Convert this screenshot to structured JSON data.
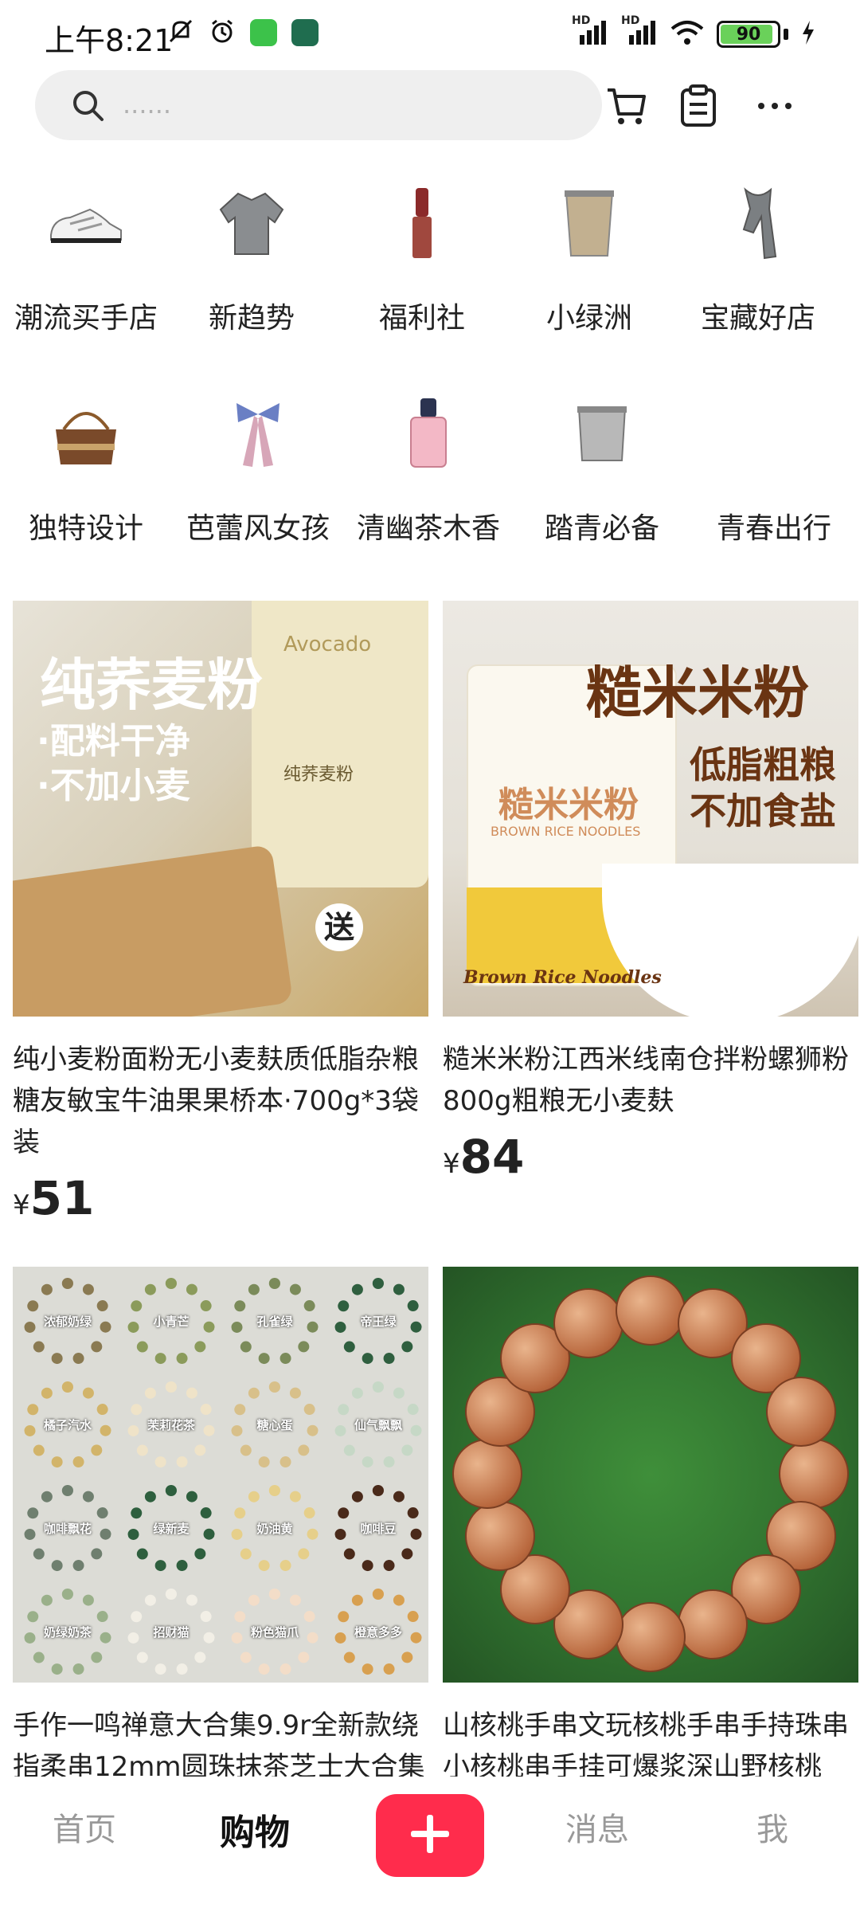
{
  "status_bar": {
    "time": "上午8:21",
    "net1": "HD",
    "net2": "HD",
    "battery_percent": 90
  },
  "search": {
    "placeholder": "......"
  },
  "categories": [
    {
      "label": "潮流买手店",
      "icon": "sneaker-icon"
    },
    {
      "label": "新趋势",
      "icon": "sweater-icon"
    },
    {
      "label": "福利社",
      "icon": "lipstick-icon"
    },
    {
      "label": "小绿洲",
      "icon": "cup-icon"
    },
    {
      "label": "宝藏好店",
      "icon": "scarf-icon"
    },
    {
      "label": "独特设计",
      "icon": "handbag-icon"
    },
    {
      "label": "芭蕾风女孩",
      "icon": "ribbon-icon"
    },
    {
      "label": "清幽茶木香",
      "icon": "perfume-icon"
    },
    {
      "label": "踏青必备",
      "icon": "steel-cup-icon"
    },
    {
      "label": "青春出行",
      "icon": "travel-icon"
    }
  ],
  "products": [
    {
      "title": "纯小麦粉面粉无小麦麸质低脂杂粮糖友敏宝牛油果果桥本·700g*3袋装",
      "price_symbol": "¥",
      "price": "51",
      "image_text": {
        "headline": "纯荞麦粉",
        "line1": "·配料干净",
        "line2": "·不加小麦",
        "badge": "送",
        "brand": "Avocado",
        "pack": "纯荞麦粉"
      }
    },
    {
      "title": "糙米米粉江西米线南仓拌粉螺狮粉800g粗粮无小麦麸",
      "price_symbol": "¥",
      "price": "84",
      "image_text": {
        "headline": "糙米米粉",
        "line1": "低脂粗粮",
        "line2": "不加食盐",
        "pack": "糙米米粉",
        "pack_en": "BROWN RICE NOODLES",
        "script": "Brown Rice Noodles"
      }
    },
    {
      "title": "手作一鸣禅意大合集9.9r全新款绕指柔串12mm圆珠抹茶芝士大合集",
      "image_text": {
        "labels": [
          "浓郁奶绿",
          "小青芒",
          "孔雀绿",
          "帝王绿",
          "橘子汽水",
          "茉莉花茶",
          "糖心蛋",
          "仙气飘飘",
          "咖啡飘花",
          "绿新麦",
          "奶油黄",
          "咖啡豆",
          "奶绿奶茶",
          "招财猫",
          "粉色猫爪",
          "橙意多多"
        ]
      }
    },
    {
      "title": "山核桃手串文玩核桃手串手持珠串小核桃串手挂可爆浆深山野核桃"
    }
  ],
  "bottom_nav": {
    "home": "首页",
    "shop": "购物",
    "messages": "消息",
    "me": "我"
  },
  "colors": {
    "accent": "#ff2c4c",
    "search_bg": "#efefef",
    "battery": "#6ad15a"
  }
}
